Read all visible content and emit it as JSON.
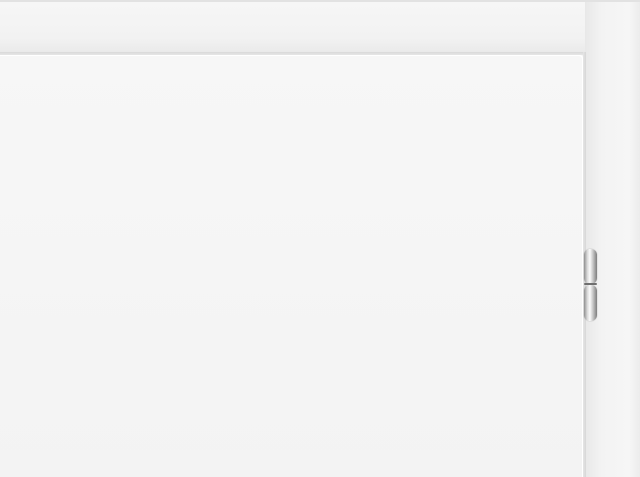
{
  "scene": {
    "subject": "door-frame-with-hinge",
    "colors": {
      "door_leaf": "#f5f5f5",
      "frame": "#f3f3f3",
      "shadow": "#d8d8d8",
      "hinge_metal": "#c4c4c4"
    }
  }
}
